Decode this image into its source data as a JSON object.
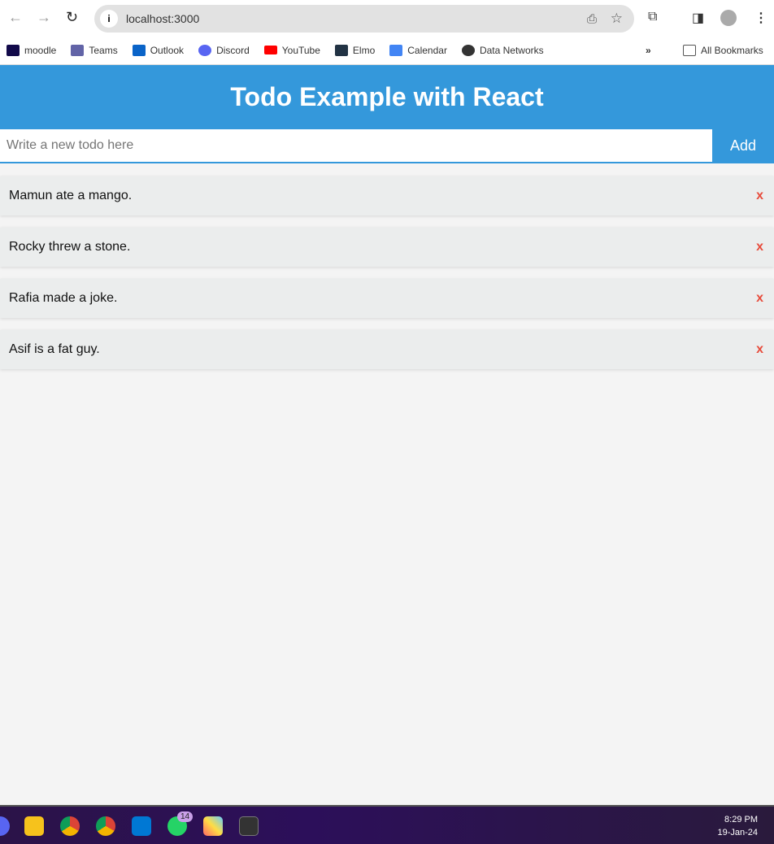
{
  "browser": {
    "url": "localhost:3000",
    "bookmarks": [
      "moodle",
      "Teams",
      "Outlook",
      "Discord",
      "YouTube",
      "Elmo",
      "Calendar",
      "Data Networks"
    ],
    "all_bookmarks": "All Bookmarks",
    "more": "»"
  },
  "app": {
    "title": "Todo Example with React",
    "input_placeholder": "Write a new todo here",
    "add_label": "Add",
    "delete_label": "x",
    "todos": [
      "Mamun ate a mango.",
      "Rocky threw a stone.",
      "Rafia made a joke.",
      "Asif is a fat guy."
    ]
  },
  "taskbar": {
    "time": "8:29 PM",
    "date": "19-Jan-24",
    "whatsapp_badge": "14"
  },
  "colors": {
    "accent": "#3498db",
    "delete": "#e74c3c"
  }
}
